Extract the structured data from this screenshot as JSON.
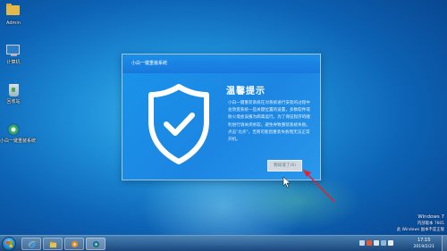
{
  "desktop": {
    "icons": [
      {
        "label": "Admin",
        "icon": "folder-icon"
      },
      {
        "label": "计算机",
        "icon": "computer-icon"
      },
      {
        "label": "回收站",
        "icon": "recycle-bin-icon"
      },
      {
        "label": "小白一键重装系统",
        "icon": "app-icon"
      }
    ]
  },
  "dialog": {
    "title": "小白一键重装系统",
    "heading": "温馨提示",
    "description": "小白一键重装系统在对系统进行安装的过程中会改变系统一些关键位置的设置，多数软件或防火墙会误报为病毒运行。为了保证程序的顺利进行请关闭杀软，避免导致重装系统失败。点击\"允许\"，否则可能因重装失败而无法正常开机。",
    "confirm_button": "我知道了(6)"
  },
  "watermark": {
    "line1": "Windows 7",
    "line2": "内部版本 7601",
    "line3": "此 Windows 副本不是正版"
  },
  "taskbar": {
    "time": "17:15",
    "date": "2019/2/21",
    "pinned": [
      "ie-icon",
      "explorer-icon",
      "media-player-icon",
      "app-icon"
    ]
  },
  "colors": {
    "dialog_accent": "#1a8de8",
    "annotation_arrow": "#e8202a"
  }
}
